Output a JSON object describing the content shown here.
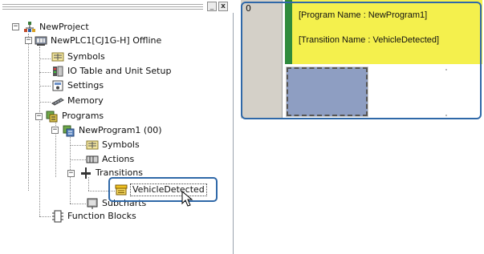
{
  "window": {
    "minimize_glyph": "_",
    "close_glyph": "x"
  },
  "tree": {
    "root": {
      "label": "NewProject",
      "icon": "project-icon"
    },
    "plc": {
      "label": "NewPLC1[CJ1G-H] Offline",
      "icon": "plc-icon"
    },
    "symbols": {
      "label": "Symbols",
      "icon": "symbols-icon"
    },
    "io_table": {
      "label": "IO Table and Unit Setup",
      "icon": "io-table-icon"
    },
    "settings": {
      "label": "Settings",
      "icon": "settings-icon"
    },
    "memory": {
      "label": "Memory",
      "icon": "memory-icon"
    },
    "programs": {
      "label": "Programs",
      "icon": "programs-icon"
    },
    "program1": {
      "label": "NewProgram1 (00)",
      "icon": "program-icon"
    },
    "program_symbols": {
      "label": "Symbols",
      "icon": "symbols-icon"
    },
    "actions": {
      "label": "Actions",
      "icon": "actions-icon"
    },
    "transitions": {
      "label": "Transitions",
      "icon": "transitions-icon"
    },
    "vehicle_detected": {
      "label": "VehicleDetected",
      "icon": "transition-icon",
      "selected": true
    },
    "subcharts": {
      "label": "Subcharts",
      "icon": "subcharts-icon"
    },
    "function_blocks": {
      "label": "Function Blocks",
      "icon": "function-blocks-icon"
    }
  },
  "editor": {
    "row_number": "0",
    "program_name_text": "[Program Name : NewProgram1]",
    "transition_name_text": "[Transition Name : VehicleDetected]"
  },
  "colors": {
    "sfc_block": "#f4f04d",
    "sfc_bar": "#2f8a3c",
    "sfc_step": "#8e9ec2",
    "callout": "#2f68a8"
  }
}
